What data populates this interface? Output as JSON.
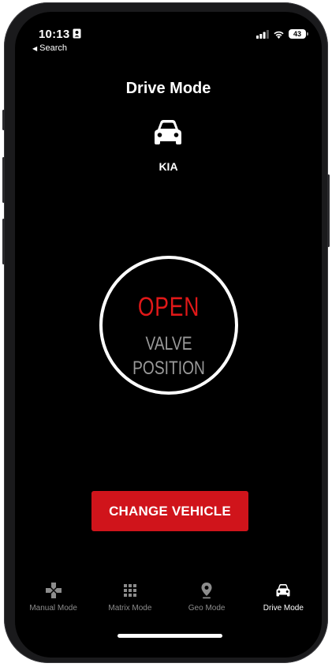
{
  "status_bar": {
    "time": "10:13",
    "back_label": "Search",
    "battery_level": "43"
  },
  "header": {
    "title": "Drive Mode"
  },
  "vehicle": {
    "name": "KIA",
    "icon": "car-icon"
  },
  "valve": {
    "state": "OPEN",
    "label_line1": "VALVE",
    "label_line2": "POSITION",
    "state_color": "#e01818"
  },
  "actions": {
    "change_vehicle_label": "CHANGE VEHICLE",
    "button_color": "#d0141b"
  },
  "tabbar": {
    "tabs": [
      {
        "label": "Manual Mode",
        "icon": "gamepad-icon",
        "active": false
      },
      {
        "label": "Matrix Mode",
        "icon": "grid-icon",
        "active": false
      },
      {
        "label": "Geo Mode",
        "icon": "location-pin-icon",
        "active": false
      },
      {
        "label": "Drive Mode",
        "icon": "car-icon",
        "active": true
      }
    ]
  }
}
